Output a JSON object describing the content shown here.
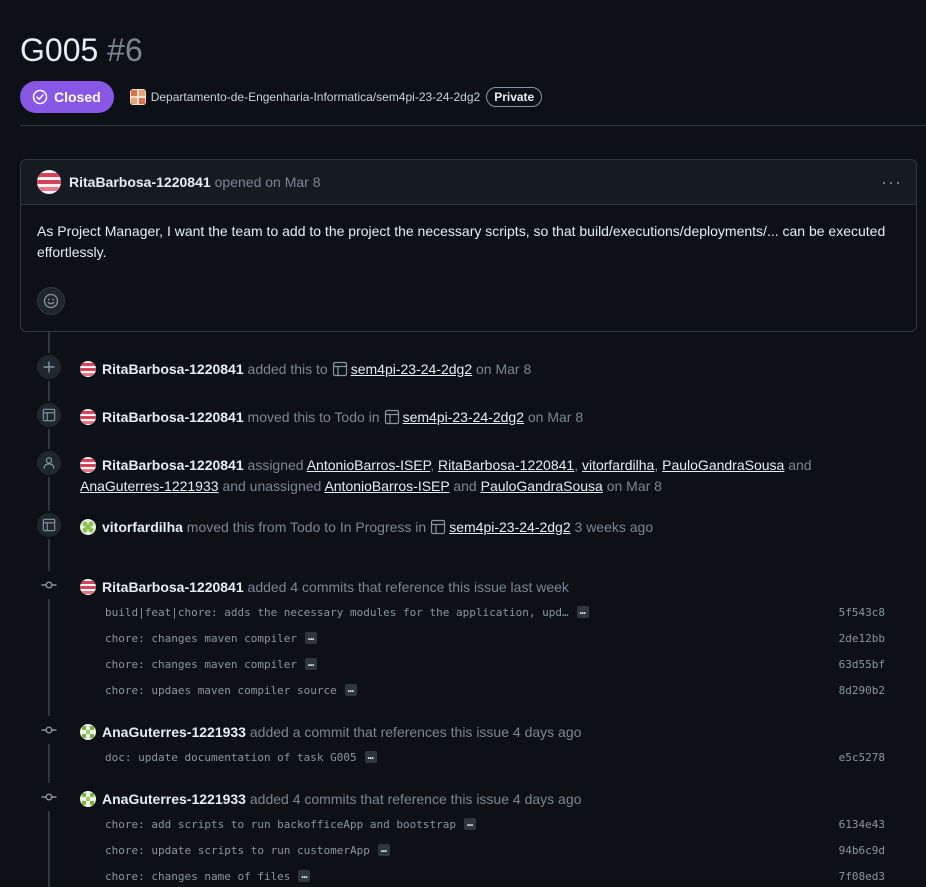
{
  "issue": {
    "title": "G005",
    "number": "#6",
    "state": "Closed",
    "repo": "Departamento-de-Engenharia-Informatica/sem4pi-23-24-2dg2",
    "visibility": "Private"
  },
  "comment": {
    "author": "RitaBarbosa-1220841",
    "action": "opened on Mar 8",
    "body": "As Project Manager, I want the team to add to the project the necessary scripts, so that build/executions/deployments/... can be executed effortlessly."
  },
  "events": {
    "e1": {
      "actor": "RitaBarbosa-1220841",
      "pre": "added this to",
      "project": "sem4pi-23-24-2dg2",
      "post": "on Mar 8"
    },
    "e2": {
      "actor": "RitaBarbosa-1220841",
      "pre": "moved this to Todo in",
      "project": "sem4pi-23-24-2dg2",
      "post": "on Mar 8"
    },
    "e3": {
      "actor": "RitaBarbosa-1220841",
      "assigned": "assigned",
      "a1": "AntonioBarros-ISEP",
      "a2": "RitaBarbosa-1220841",
      "a3": "vitorfardilha",
      "a4": "PauloGandraSousa",
      "and1": "and",
      "a5": "AnaGuterres-1221933",
      "unassigned": "and unassigned",
      "u1": "AntonioBarros-ISEP",
      "and2": "and",
      "u2": "PauloGandraSousa",
      "post": "on Mar 8"
    },
    "e4": {
      "actor": "vitorfardilha",
      "pre": "moved this from Todo to In Progress in",
      "project": "sem4pi-23-24-2dg2",
      "post": "3 weeks ago"
    },
    "e5": {
      "actor": "RitaBarbosa-1220841",
      "text": "added 4 commits that reference this issue last week",
      "commits": [
        {
          "msg": "build|feat|chore: adds the necessary modules for the application, upd…",
          "sha": "5f543c8"
        },
        {
          "msg": "chore: changes maven compiler",
          "sha": "2de12bb"
        },
        {
          "msg": "chore: changes maven compiler",
          "sha": "63d55bf"
        },
        {
          "msg": "chore: updaes maven compiler source",
          "sha": "8d290b2"
        }
      ]
    },
    "e6": {
      "actor": "AnaGuterres-1221933",
      "text": "added a commit that references this issue 4 days ago",
      "commits": [
        {
          "msg": "doc: update documentation of task G005",
          "sha": "e5c5278"
        }
      ]
    },
    "e7": {
      "actor": "AnaGuterres-1221933",
      "text": "added 4 commits that reference this issue 4 days ago",
      "commits": [
        {
          "msg": "chore: add scripts to run backofficeApp and bootstrap",
          "sha": "6134e43"
        },
        {
          "msg": "chore: update scripts to run customerApp",
          "sha": "94b6c9d"
        },
        {
          "msg": "chore: changes name of files",
          "sha": "7f08ed3"
        }
      ]
    }
  },
  "ui": {
    "more_dots": "…",
    "kebab": "···"
  },
  "colors": {
    "closed": "#8957e5",
    "bg": "#0d1117",
    "border": "#30363d"
  }
}
